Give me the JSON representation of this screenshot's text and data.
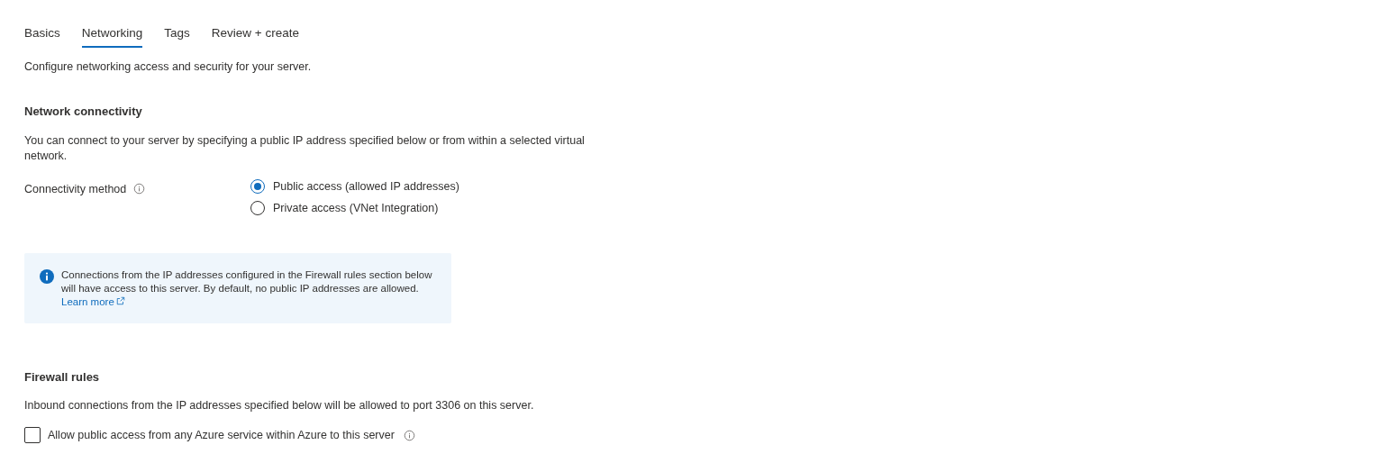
{
  "tabs": [
    {
      "label": "Basics",
      "selected": false
    },
    {
      "label": "Networking",
      "selected": true
    },
    {
      "label": "Tags",
      "selected": false
    },
    {
      "label": "Review + create",
      "selected": false
    }
  ],
  "intro": "Configure networking access and security for your server.",
  "network_connectivity": {
    "heading": "Network connectivity",
    "description": "You can connect to your server by specifying a public IP address specified below or from within a selected virtual network.",
    "connectivity_method": {
      "label": "Connectivity method",
      "options": [
        {
          "label": "Public access (allowed IP addresses)",
          "selected": true
        },
        {
          "label": "Private access (VNet Integration)",
          "selected": false
        }
      ]
    },
    "info": {
      "text": "Connections from the IP addresses configured in the Firewall rules section below will have access to this server. By default, no public IP addresses are allowed.",
      "link": "Learn more"
    }
  },
  "firewall_rules": {
    "heading": "Firewall rules",
    "description": "Inbound connections from the IP addresses specified below will be allowed to port 3306 on this server.",
    "allow_azure": {
      "label": "Allow public access from any Azure service within Azure to this server",
      "checked": false
    }
  }
}
